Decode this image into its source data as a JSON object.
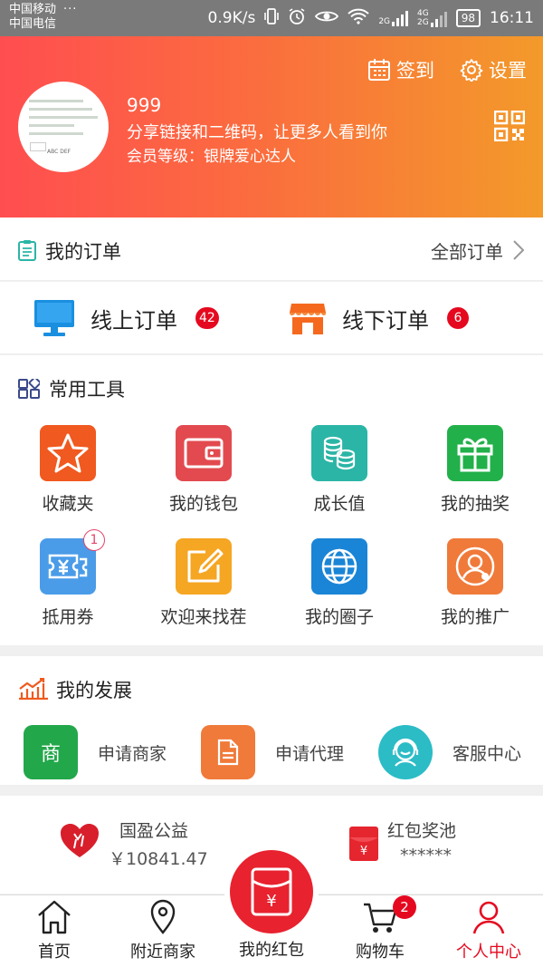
{
  "status_bar": {
    "carrier1": "中国移动",
    "carrier2": "中国电信",
    "dots": "···",
    "speed": "0.9K/s",
    "net1": "2G",
    "net2": "4G",
    "net3": "2G",
    "battery": "98",
    "time": "16:11"
  },
  "header": {
    "checkin_label": "签到",
    "settings_label": "设置",
    "username": "999",
    "share_text": "分享链接和二维码，让更多人看到你",
    "member_level": "会员等级：银牌爱心达人",
    "avatar_keys": [
      "ABC",
      "DEF"
    ]
  },
  "orders": {
    "title": "我的订单",
    "all_label": "全部订单",
    "online_label": "线上订单",
    "online_count": "42",
    "offline_label": "线下订单",
    "offline_count": "6"
  },
  "tools": {
    "title": "常用工具",
    "items": [
      {
        "label": "收藏夹",
        "color": "#f0591f",
        "icon": "star-icon"
      },
      {
        "label": "我的钱包",
        "color": "#e24a4f",
        "icon": "wallet-icon"
      },
      {
        "label": "成长值",
        "color": "#2bb5a6",
        "icon": "coins-icon"
      },
      {
        "label": "我的抽奖",
        "color": "#22b04a",
        "icon": "gift-icon"
      },
      {
        "label": "抵用券",
        "color": "#4a9ce8",
        "icon": "coupon-icon",
        "badge": "1"
      },
      {
        "label": "欢迎来找茬",
        "color": "#f5a623",
        "icon": "edit-icon"
      },
      {
        "label": "我的圈子",
        "color": "#1a85d6",
        "icon": "globe-icon"
      },
      {
        "label": "我的推广",
        "color": "#f07a3a",
        "icon": "person-icon"
      }
    ]
  },
  "development": {
    "title": "我的发展",
    "items": [
      {
        "label": "申请商家",
        "icon_text": "商",
        "color": "#22a74a",
        "icon": "shop-icon"
      },
      {
        "label": "申请代理",
        "color": "#f07a3a",
        "icon": "document-icon"
      },
      {
        "label": "客服中心",
        "color": "#2bbcc6",
        "icon": "customer-service-icon"
      }
    ]
  },
  "welfare": {
    "charity_name": "国盈公益",
    "charity_value": "￥10841.47",
    "pool_name": "红包奖池",
    "pool_value": "******"
  },
  "tabbar": {
    "home": "首页",
    "nearby": "附近商家",
    "redpacket": "我的红包",
    "cart": "购物车",
    "cart_count": "2",
    "profile": "个人中心"
  }
}
